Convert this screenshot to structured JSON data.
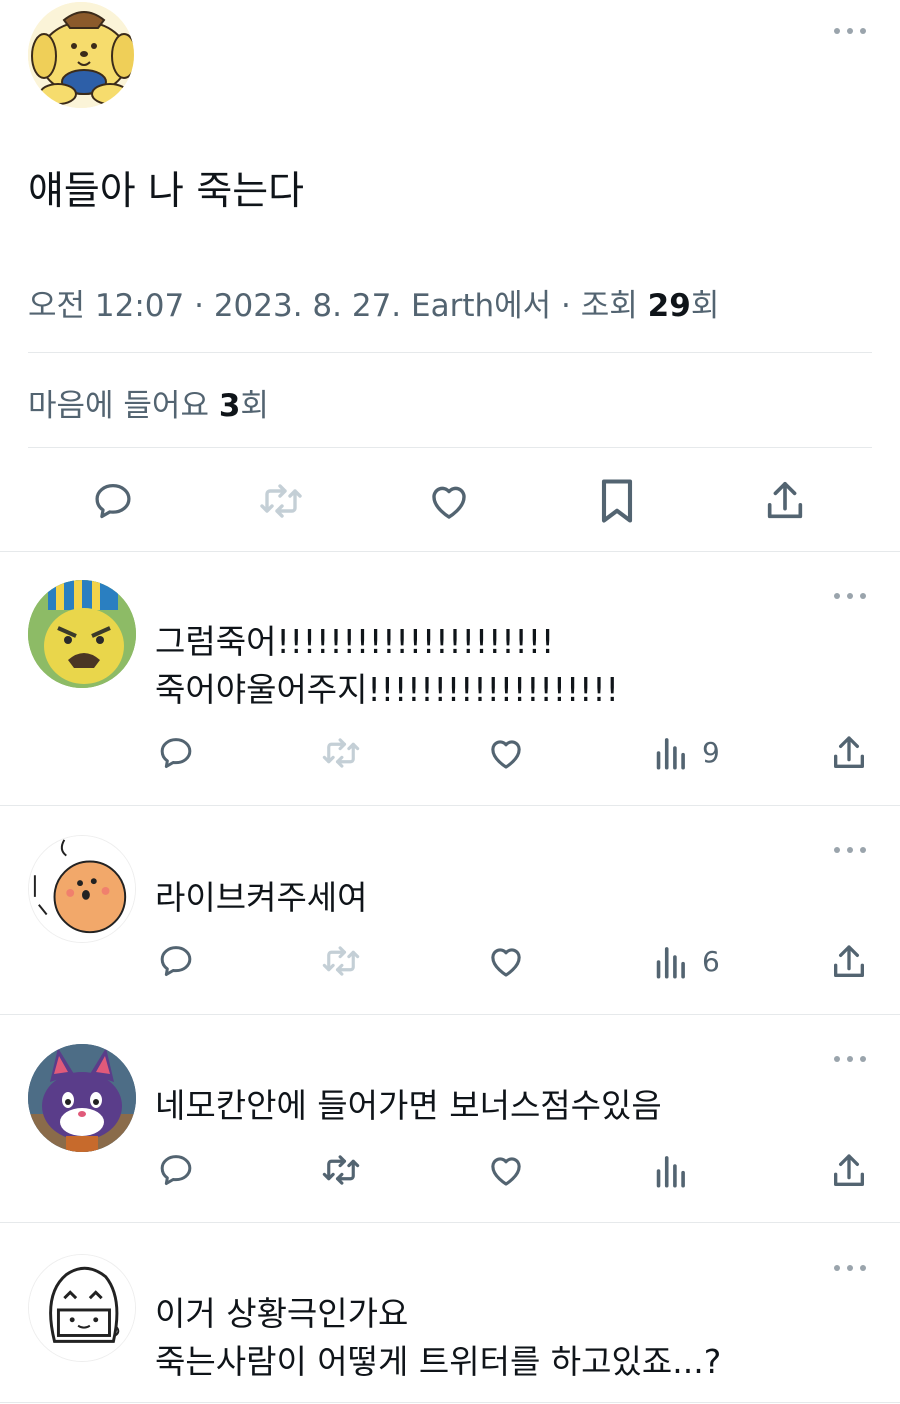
{
  "main_tweet": {
    "avatar_icon": "pompompurin-avatar",
    "text": "얘들아 나 죽는다",
    "meta": {
      "time": "오전 12:07",
      "date": "2023. 8. 27.",
      "source": "Earth에서",
      "views_label": "조회",
      "views_count": "29",
      "views_suffix": "회"
    },
    "likes": {
      "label": "마음에 들어요",
      "count": "3",
      "suffix": "회"
    },
    "actions": [
      "reply-icon",
      "retweet-icon",
      "like-icon",
      "bookmark-icon",
      "share-icon"
    ]
  },
  "replies": [
    {
      "avatar_icon": "yellow-character-avatar",
      "lines": [
        "그럼죽어!!!!!!!!!!!!!!!!!!!!!",
        "죽어야울어주지!!!!!!!!!!!!!!!!!!!"
      ],
      "views": "9"
    },
    {
      "avatar_icon": "orange-character-avatar",
      "lines": [
        "라이브켜주세여"
      ],
      "views": "6"
    },
    {
      "avatar_icon": "purple-cat-avatar",
      "lines": [
        "네모칸안에 들어가면 보너스점수있음"
      ],
      "views": ""
    },
    {
      "avatar_icon": "doodle-face-avatar",
      "lines": [
        "이거 상황극인가요",
        "죽는사람이 어떻게 트위터를 하고있죠...?"
      ]
    }
  ],
  "colors": {
    "text_primary": "#0f1419",
    "text_secondary": "#536471",
    "icon": "#536471",
    "icon_disabled": "#c4cfd6",
    "divider": "#e6e9eb"
  }
}
